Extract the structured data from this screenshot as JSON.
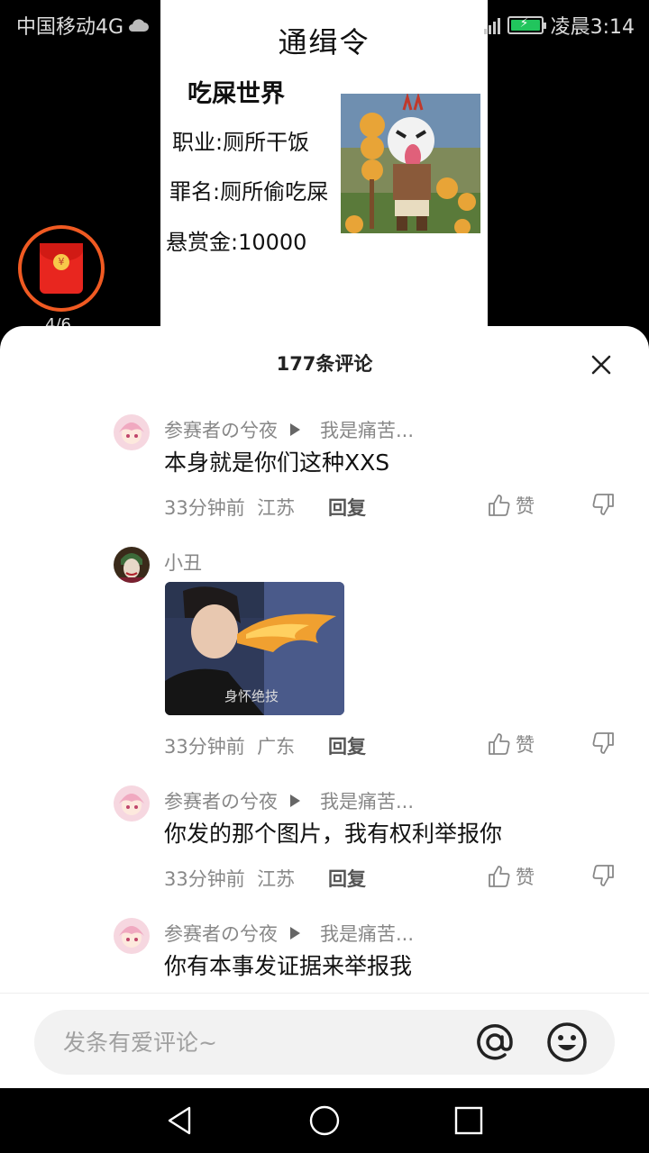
{
  "status_bar": {
    "carrier": "中国移动4G",
    "time": "凌晨3:14"
  },
  "poster": {
    "title": "通缉令",
    "name": "吃屎世界",
    "occupation": "职业:厕所干饭",
    "crime": "罪名:厕所偷吃屎",
    "bounty": "悬赏金:10000"
  },
  "redpack": {
    "count": "4/6"
  },
  "comments_panel": {
    "title": "177条评论",
    "comments": [
      {
        "user": "参赛者の兮夜",
        "reply_to": "我是痛苦...",
        "text": "本身就是你们这种XXS",
        "time": "33分钟前",
        "location": "江苏",
        "reply_label": "回复",
        "like_label": "赞"
      },
      {
        "user": "小丑",
        "reply_to": "",
        "image_caption": "身怀绝技",
        "time": "33分钟前",
        "location": "广东",
        "reply_label": "回复",
        "like_label": "赞"
      },
      {
        "user": "参赛者の兮夜",
        "reply_to": "我是痛苦...",
        "text": "你发的那个图片，我有权利举报你",
        "time": "33分钟前",
        "location": "江苏",
        "reply_label": "回复",
        "like_label": "赞"
      },
      {
        "user": "参赛者の兮夜",
        "reply_to": "我是痛苦...",
        "text": "你有本事发证据来举报我"
      }
    ]
  },
  "input": {
    "placeholder": "发条有爱评论~"
  },
  "colors": {
    "accent_orange": "#f05a22",
    "redpack_red": "#e8261f",
    "battery_green": "#21c55d"
  }
}
